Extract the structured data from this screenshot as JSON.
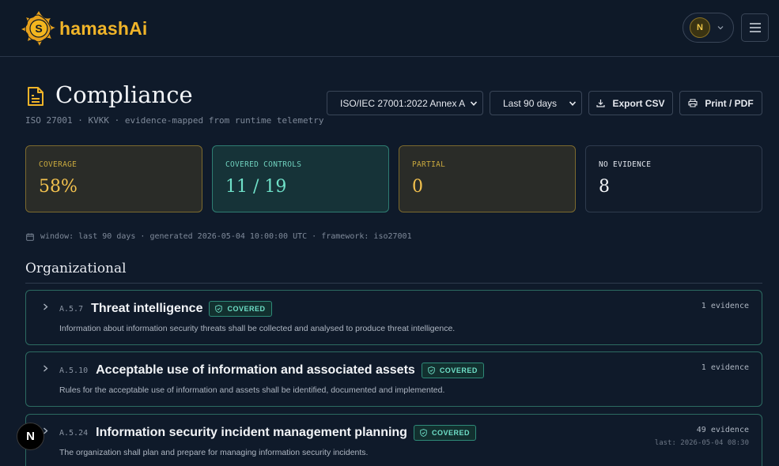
{
  "brand": {
    "name": "hamashAi",
    "accent": "#f0b429"
  },
  "user": {
    "initial": "N"
  },
  "page": {
    "title": "Compliance",
    "subtitle": "ISO 27001 · KVKK · evidence-mapped from runtime telemetry"
  },
  "filters": {
    "framework": "ISO/IEC 27001:2022 Annex A",
    "window": "Last 90 days"
  },
  "actions": {
    "export_csv": "Export CSV",
    "print_pdf": "Print / PDF"
  },
  "stats": [
    {
      "label": "COVERAGE",
      "value": "58%"
    },
    {
      "label": "COVERED CONTROLS",
      "value": "11 / 19"
    },
    {
      "label": "PARTIAL",
      "value": "0"
    },
    {
      "label": "NO EVIDENCE",
      "value": "8"
    }
  ],
  "meta": "window: last 90 days · generated 2026-05-04 10:00:00 UTC · framework: iso27001",
  "section": "Organizational",
  "controls": [
    {
      "id": "A.5.7",
      "name": "Threat intelligence",
      "status": "COVERED",
      "description": "Information about information security threats shall be collected and analysed to produce threat intelligence.",
      "evidence": "1 evidence",
      "last": ""
    },
    {
      "id": "A.5.10",
      "name": "Acceptable use of information and associated assets",
      "status": "COVERED",
      "description": "Rules for the acceptable use of information and assets shall be identified, documented and implemented.",
      "evidence": "1 evidence",
      "last": ""
    },
    {
      "id": "A.5.24",
      "name": "Information security incident management planning",
      "status": "COVERED",
      "description": "The organization shall plan and prepare for managing information security incidents.",
      "evidence": "49 evidence",
      "last": "last: 2026-05-04 08:30"
    }
  ],
  "fab": {
    "label": "N"
  }
}
